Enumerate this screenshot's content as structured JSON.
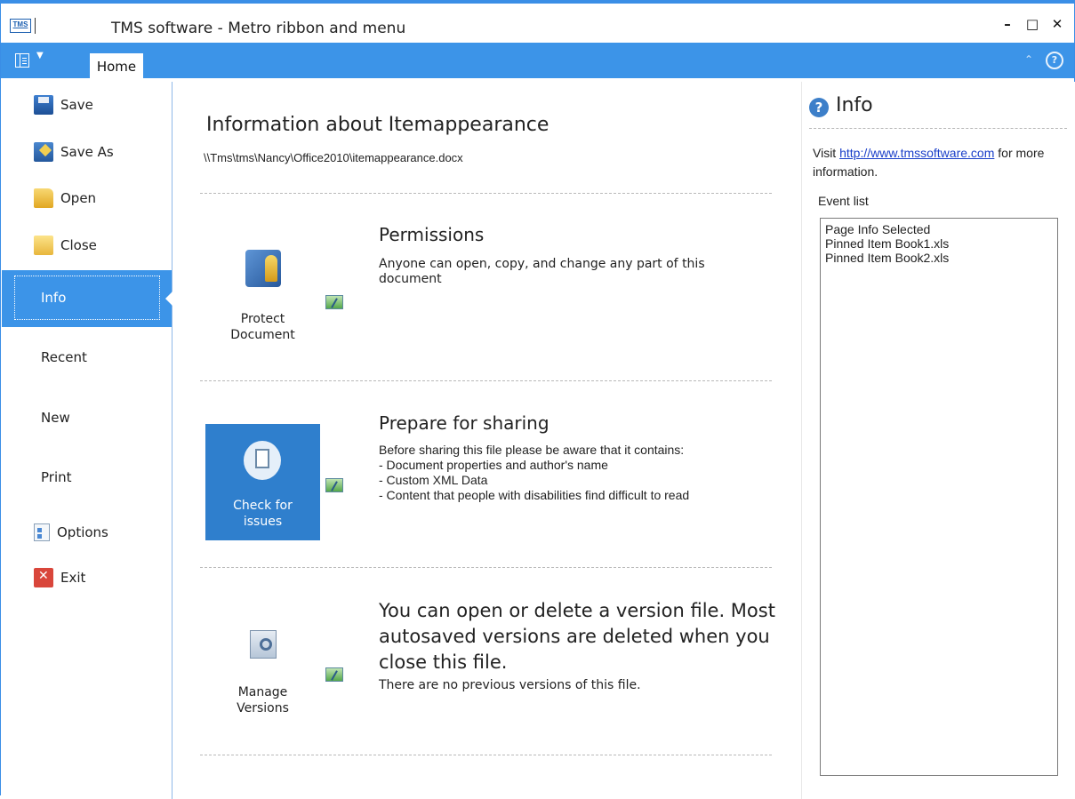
{
  "window": {
    "badge": "TMS",
    "title": "TMS software - Metro ribbon and menu",
    "minimize": "–",
    "maximize": "□",
    "close": "✕"
  },
  "ribbon": {
    "tabs": [
      {
        "label": "Home"
      }
    ],
    "collapse_icon": "⌃",
    "help_icon": "?"
  },
  "menu": {
    "commands": [
      {
        "label": "Save",
        "icon": "save-icon"
      },
      {
        "label": "Save As",
        "icon": "save-as-icon"
      },
      {
        "label": "Open",
        "icon": "open-folder-icon"
      },
      {
        "label": "Close",
        "icon": "close-folder-icon"
      }
    ],
    "tabs": [
      {
        "label": "Info",
        "active": true
      },
      {
        "label": "Recent"
      },
      {
        "label": "New"
      },
      {
        "label": "Print"
      }
    ],
    "bottom_commands": [
      {
        "label": "Options",
        "icon": "options-icon"
      },
      {
        "label": "Exit",
        "icon": "exit-icon"
      }
    ]
  },
  "main": {
    "title": "Information about Itemappearance",
    "path": "\\\\Tms\\tms\\Nancy\\Office2010\\itemappearance.docx",
    "sections": [
      {
        "button_label_1": "Protect",
        "button_label_2": "Document",
        "heading": "Permissions",
        "body": "Anyone can open, copy, and change any part of this document"
      },
      {
        "button_label_1": "Check for",
        "button_label_2": "issues",
        "heading": "Prepare for sharing",
        "lines": [
          "Before sharing this file please be aware that it contains:",
          "- Document properties and author's name",
          "- Custom XML Data",
          "- Content that people with disabilities find difficult to read"
        ]
      },
      {
        "button_label_1": "Manage",
        "button_label_2": "Versions",
        "heading": "You can open or delete a version file. Most autosaved versions are deleted when you close this file.",
        "body": "There are no previous versions of this file."
      }
    ]
  },
  "panel": {
    "title": "Info",
    "visit_prefix": "Visit ",
    "link": "http://www.tmssoftware.com",
    "visit_suffix": " for more information.",
    "event_label": "Event list",
    "events": [
      "Page Info Selected",
      "Pinned Item Book1.xls",
      "Pinned Item Book2.xls"
    ]
  },
  "colors": {
    "accent": "#3c94e8",
    "highlight": "#2f7fcd"
  }
}
